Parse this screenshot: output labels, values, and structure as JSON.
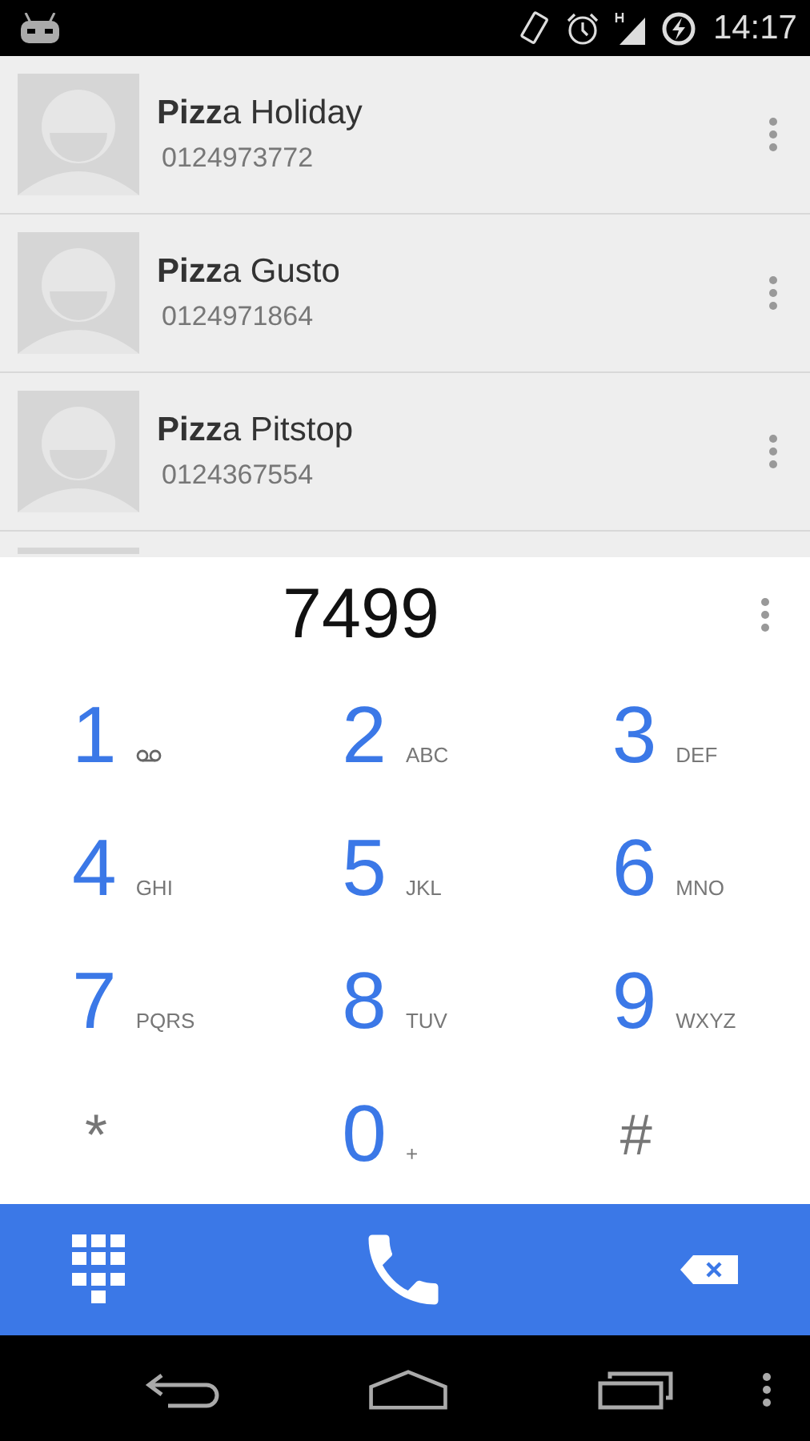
{
  "status_bar": {
    "time": "14:17"
  },
  "contacts": [
    {
      "name": "**Pizz**a Holiday",
      "number": "0124973772"
    },
    {
      "name": "**Pizz**a Gusto",
      "number": "0124971864"
    },
    {
      "name": "**Pizz**a Pitstop",
      "number": "0124367554"
    }
  ],
  "dialer": {
    "number": "7499",
    "keys": [
      {
        "kind": "voicemail",
        "digit": "1"
      },
      {
        "kind": "digit",
        "digit": "2",
        "letters": "ABC"
      },
      {
        "kind": "digit",
        "digit": "3",
        "letters": "DEF"
      },
      {
        "kind": "digit",
        "digit": "4",
        "letters": "GHI"
      },
      {
        "kind": "digit",
        "digit": "5",
        "letters": "JKL"
      },
      {
        "kind": "digit",
        "digit": "6",
        "letters": "MNO"
      },
      {
        "kind": "digit",
        "digit": "7",
        "letters": "PQRS"
      },
      {
        "kind": "digit",
        "digit": "8",
        "letters": "TUV"
      },
      {
        "kind": "digit",
        "digit": "9",
        "letters": "WXYZ"
      },
      {
        "kind": "symbol",
        "digit": "*"
      },
      {
        "kind": "digit",
        "digit": "0",
        "letters": "+"
      },
      {
        "kind": "symbol",
        "digit": "#"
      }
    ]
  }
}
